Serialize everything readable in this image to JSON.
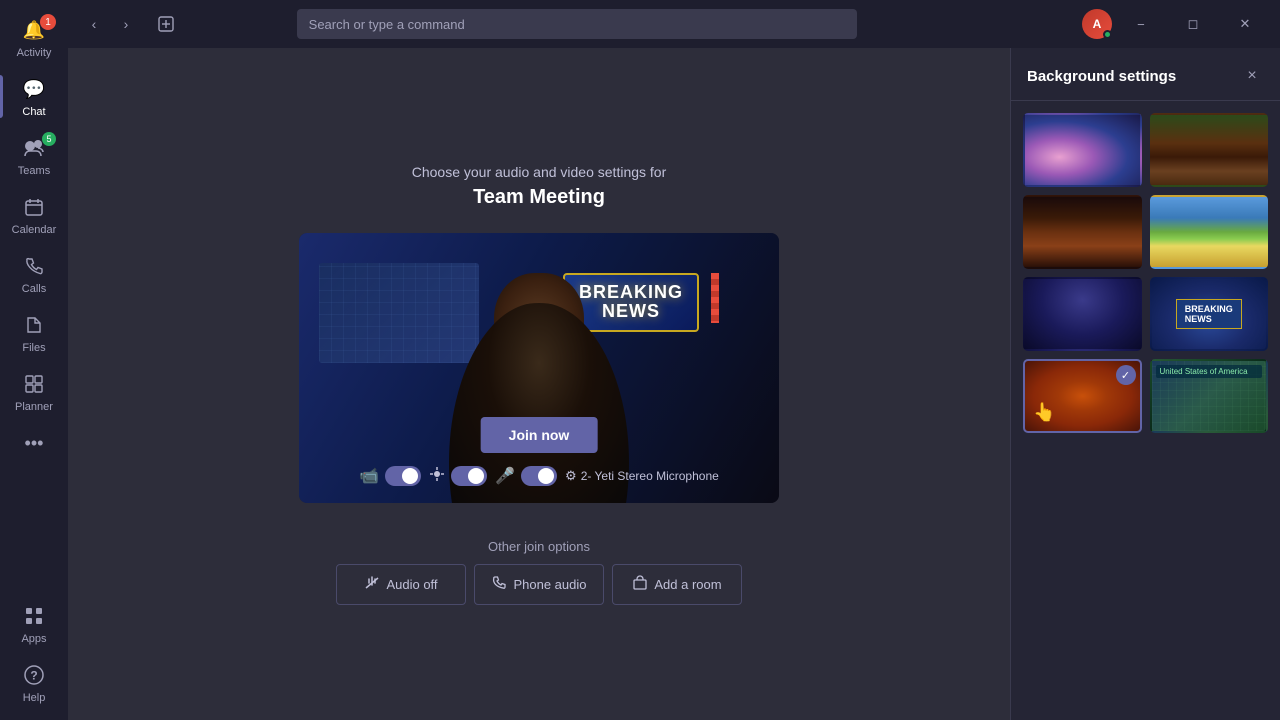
{
  "titlebar": {
    "search_placeholder": "Search or type a command",
    "back_label": "Back",
    "forward_label": "Forward",
    "compose_label": "Compose"
  },
  "sidebar": {
    "items": [
      {
        "key": "activity",
        "label": "Activity",
        "icon": "🔔",
        "badge": "1",
        "has_badge": true
      },
      {
        "key": "chat",
        "label": "Chat",
        "icon": "💬",
        "active": true
      },
      {
        "key": "teams",
        "label": "Teams",
        "icon": "👥",
        "badge_green": "5"
      },
      {
        "key": "calendar",
        "label": "Calendar",
        "icon": "📅"
      },
      {
        "key": "calls",
        "label": "Calls",
        "icon": "📞"
      },
      {
        "key": "files",
        "label": "Files",
        "icon": "📁"
      },
      {
        "key": "planner",
        "label": "Planner",
        "icon": "📋"
      }
    ],
    "more_label": "...",
    "apps_label": "Apps",
    "help_label": "Help"
  },
  "meeting": {
    "subtitle": "Choose your audio and video settings for",
    "title": "Team Meeting",
    "join_now_label": "Join now",
    "other_join_title": "Other join options",
    "controls": {
      "video_icon": "📹",
      "effects_icon": "✨",
      "mic_icon": "🎤",
      "device_label": "2- Yeti Stereo Microphone",
      "device_icon": "⚙"
    },
    "join_options": [
      {
        "key": "audio-off",
        "icon": "🔇",
        "label": "Audio off"
      },
      {
        "key": "phone-audio",
        "icon": "📞",
        "label": "Phone audio"
      },
      {
        "key": "add-room",
        "icon": "🏠",
        "label": "Add a room"
      }
    ]
  },
  "bg_panel": {
    "title": "Background settings",
    "close_label": "×",
    "backgrounds": [
      {
        "key": "galaxy",
        "css_class": "bg-galaxy",
        "label": "Galaxy",
        "selected": false
      },
      {
        "key": "canyon",
        "css_class": "bg-canyon",
        "label": "Canyon",
        "selected": false
      },
      {
        "key": "street",
        "css_class": "bg-street",
        "label": "Dark street",
        "selected": false
      },
      {
        "key": "cartoon",
        "css_class": "bg-cartoon",
        "label": "Cartoon landscape",
        "selected": false
      },
      {
        "key": "studio1",
        "css_class": "bg-studio1",
        "label": "TV Studio",
        "selected": false
      },
      {
        "key": "newsdesk",
        "css_class": "bg-newsdesk",
        "label": "News desk",
        "selected": false
      },
      {
        "key": "pizza",
        "css_class": "bg-pizza",
        "label": "Pizza",
        "selected": true
      },
      {
        "key": "map",
        "css_class": "bg-map",
        "label": "Map",
        "selected": false
      }
    ]
  }
}
